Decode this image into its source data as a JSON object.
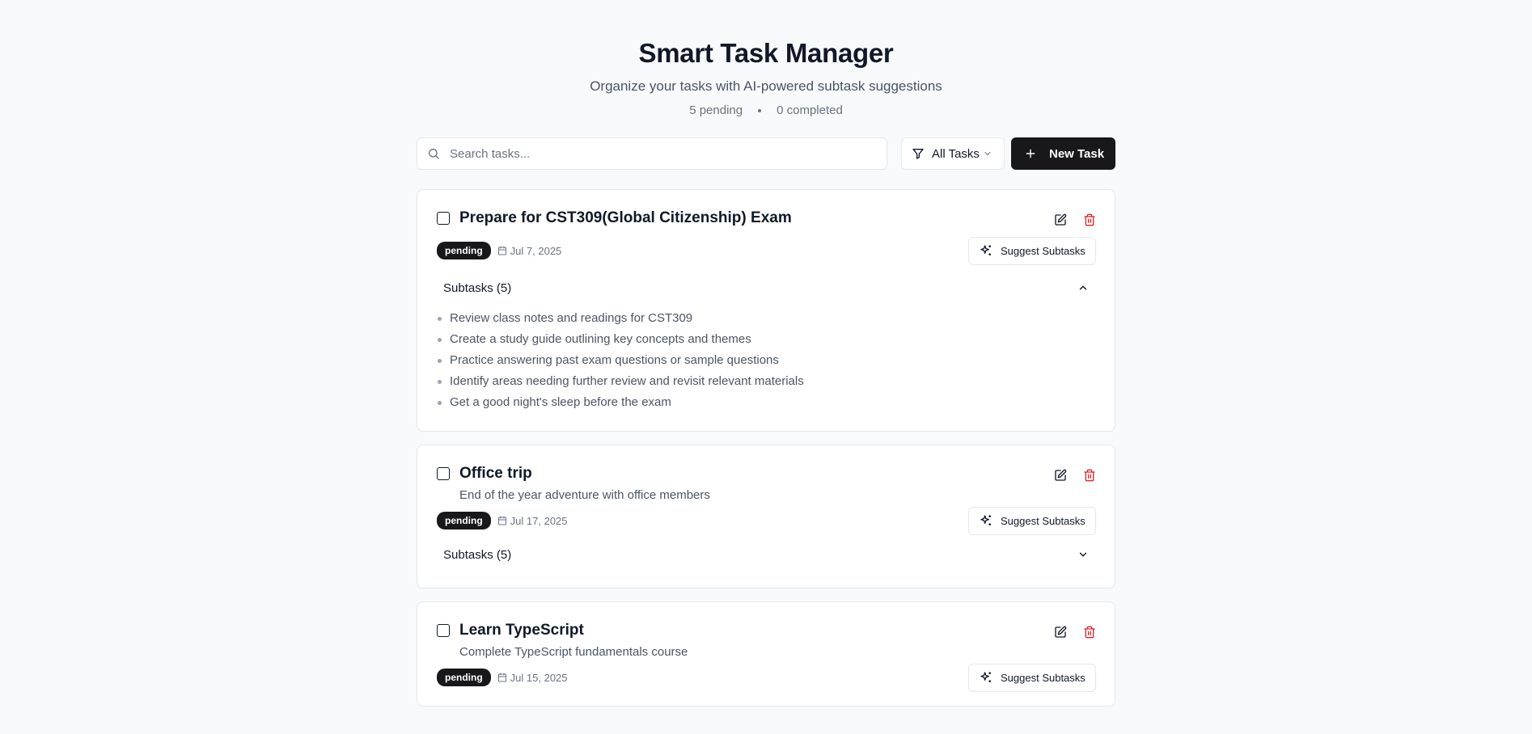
{
  "header": {
    "title": "Smart Task Manager",
    "subtitle": "Organize your tasks with AI-powered subtask suggestions",
    "pending": "5 pending",
    "completed": "0 completed"
  },
  "toolbar": {
    "search_placeholder": "Search tasks...",
    "filter_label": "All Tasks",
    "new_task_label": "New Task"
  },
  "colors": {
    "primary": "#18181b",
    "danger": "#dc2626",
    "muted": "#6b7280"
  },
  "tasks": [
    {
      "title": "Prepare for CST309(Global Citizenship) Exam",
      "description": "",
      "status": "pending",
      "date": "Jul 7, 2025",
      "suggest_label": "Suggest Subtasks",
      "subtasks_label": "Subtasks (5)",
      "expanded": true,
      "subtasks": [
        "Review class notes and readings for CST309",
        "Create a study guide outlining key concepts and themes",
        "Practice answering past exam questions or sample questions",
        "Identify areas needing further review and revisit relevant materials",
        "Get a good night's sleep before the exam"
      ]
    },
    {
      "title": "Office trip",
      "description": "End of the year adventure with office members",
      "status": "pending",
      "date": "Jul 17, 2025",
      "suggest_label": "Suggest Subtasks",
      "subtasks_label": "Subtasks (5)",
      "expanded": false
    },
    {
      "title": "Learn TypeScript",
      "description": "Complete TypeScript fundamentals course",
      "status": "pending",
      "date": "Jul 15, 2025",
      "suggest_label": "Suggest Subtasks"
    }
  ]
}
